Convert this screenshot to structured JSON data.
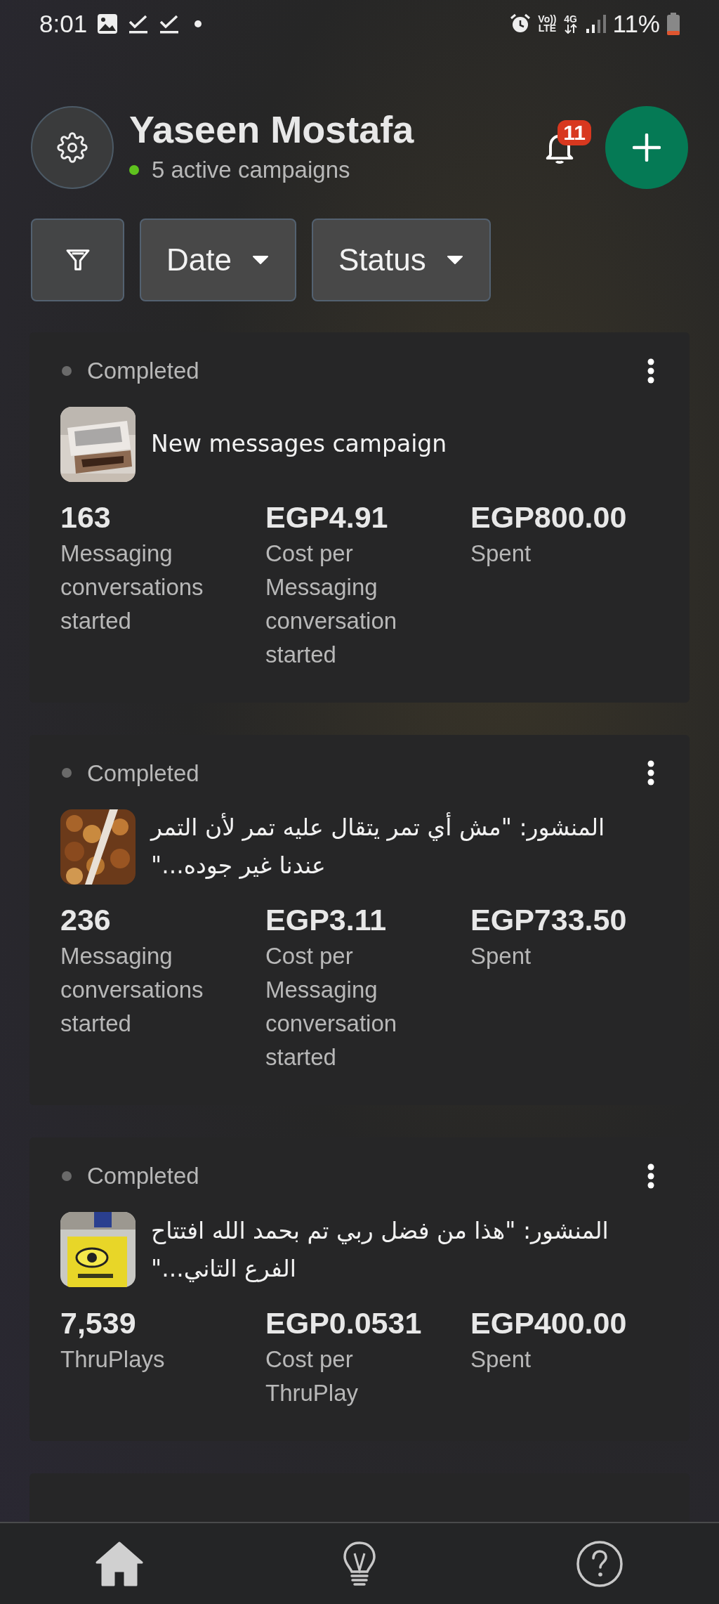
{
  "status_bar": {
    "time": "8:01",
    "network_labels": [
      "Vo))",
      "LTE",
      "4G"
    ],
    "battery": "11%"
  },
  "header": {
    "name": "Yaseen Mostafa",
    "subtitle": "5 active campaigns",
    "notification_count": "11"
  },
  "filters": [
    {
      "kind": "icon"
    },
    {
      "kind": "dropdown",
      "label": "Date"
    },
    {
      "kind": "dropdown",
      "label": "Status"
    }
  ],
  "campaigns": [
    {
      "status": "Completed",
      "title": "New messages campaign",
      "metrics": [
        {
          "value": "163",
          "label": "Messaging conversations started"
        },
        {
          "value": "EGP4.91",
          "label": "Cost per Messaging conversation started"
        },
        {
          "value": "EGP800.00",
          "label": "Spent"
        }
      ]
    },
    {
      "status": "Completed",
      "title": "المنشور: \"مش أي تمر يتقال عليه تمر لأن التمر عندنا غير جوده...\"",
      "metrics": [
        {
          "value": "236",
          "label": "Messaging conversations started"
        },
        {
          "value": "EGP3.11",
          "label": "Cost per Messaging conversation started"
        },
        {
          "value": "EGP733.50",
          "label": "Spent"
        }
      ]
    },
    {
      "status": "Completed",
      "title": "المنشور: \"هذا من فضل ربي تم بحمد الله افتتاح الفرع التاني...\"",
      "metrics": [
        {
          "value": "7,539",
          "label": "ThruPlays"
        },
        {
          "value": "EGP0.0531",
          "label": "Cost per ThruPlay"
        },
        {
          "value": "EGP400.00",
          "label": "Spent"
        }
      ]
    }
  ],
  "bottom_nav": [
    {
      "kind": "home",
      "selected": true
    },
    {
      "kind": "ideas",
      "selected": false
    },
    {
      "kind": "help",
      "selected": false
    }
  ]
}
